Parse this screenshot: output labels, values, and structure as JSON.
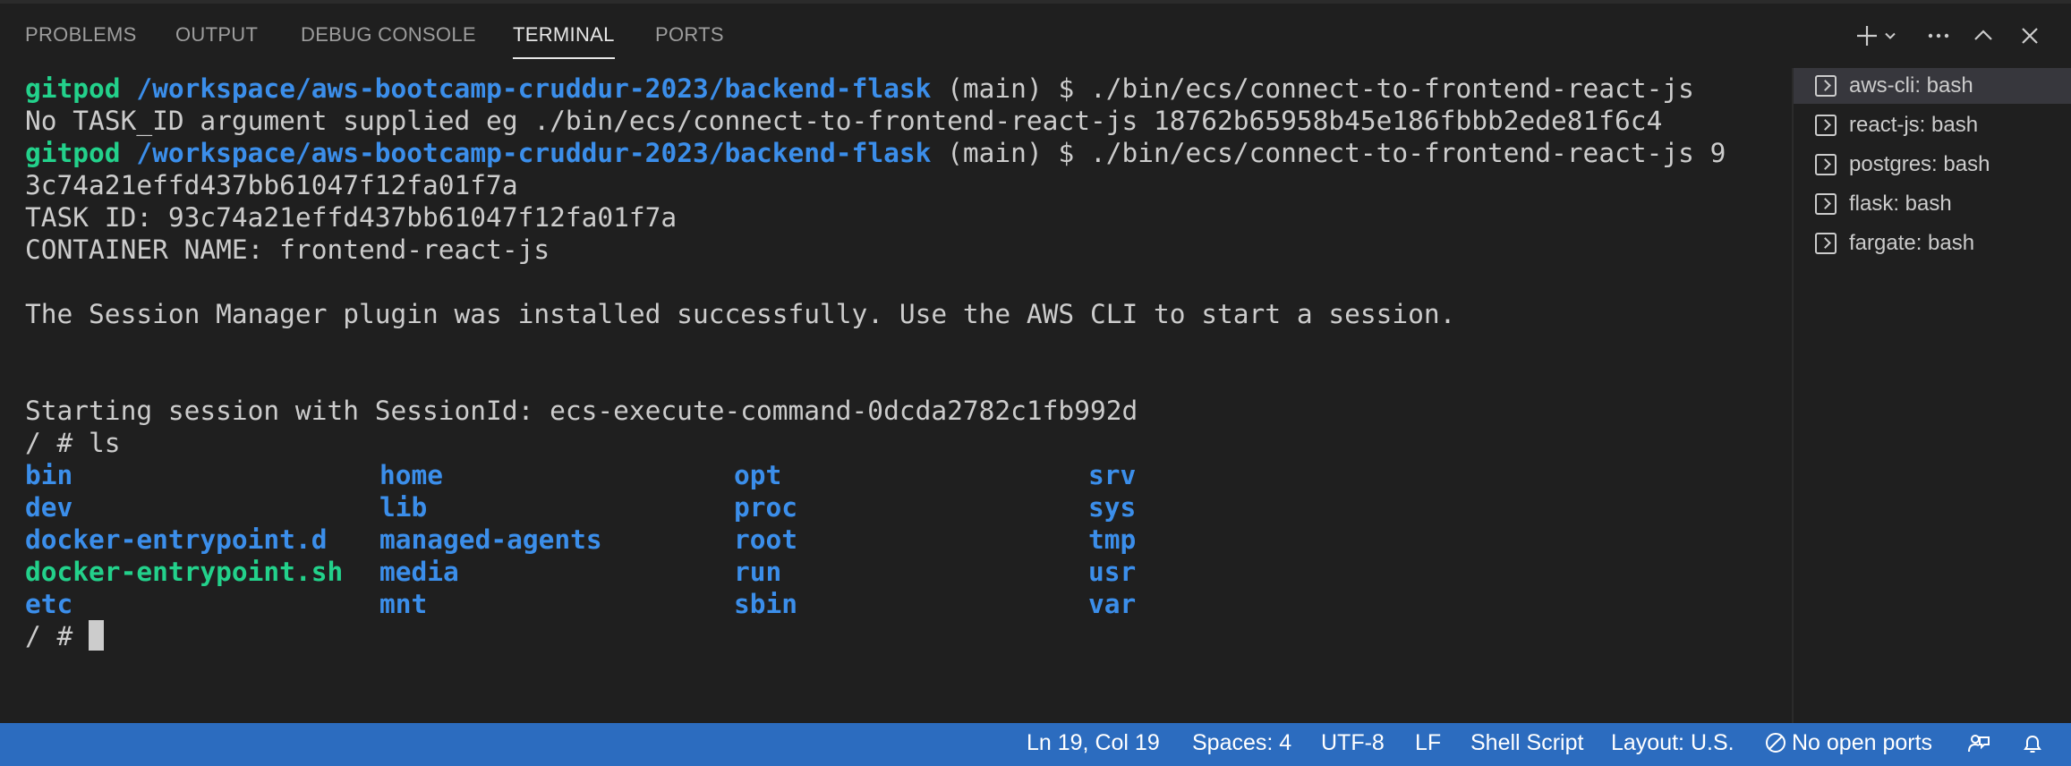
{
  "panel_tabs": [
    {
      "label": "PROBLEMS"
    },
    {
      "label": "OUTPUT"
    },
    {
      "label": "DEBUG CONSOLE"
    },
    {
      "label": "TERMINAL"
    },
    {
      "label": "PORTS"
    }
  ],
  "active_tab": "TERMINAL",
  "toolbar_icons": [
    "plus-icon",
    "chevron-down-icon",
    "more-icon",
    "chevron-up-icon",
    "close-icon"
  ],
  "terminal": {
    "prompt_user": "gitpod",
    "prompt_path": "/workspace/aws-bootcamp-cruddur-2023/backend-flask",
    "prompt_branch": " (main) $ ",
    "cmd1": "./bin/ecs/connect-to-frontend-react-js",
    "line2": "No TASK_ID argument supplied eg ./bin/ecs/connect-to-frontend-react-js 18762b65958b45e186fbbb2ede81f6c4",
    "cmd2": "./bin/ecs/connect-to-frontend-react-js 9",
    "cmd2_wrap": "3c74a21effd437bb61047f12fa01f7a",
    "task_id": "TASK ID: 93c74a21effd437bb61047f12fa01f7a",
    "container_name": "CONTAINER NAME: frontend-react-js",
    "session_plugin": "The Session Manager plugin was installed successfully. Use the AWS CLI to start a session.",
    "session_start": "Starting session with SessionId: ecs-execute-command-0dcda2782c1fb992d",
    "ls_cmd": "/ # ls",
    "prompt_final": "/ # ",
    "ls_columns": [
      [
        "bin",
        "dev",
        "docker-entrypoint.d",
        "docker-entrypoint.sh",
        "etc"
      ],
      [
        "home",
        "lib",
        "managed-agents",
        "media",
        "mnt"
      ],
      [
        "opt",
        "proc",
        "root",
        "run",
        "sbin"
      ],
      [
        "srv",
        "sys",
        "tmp",
        "usr",
        "var"
      ]
    ],
    "executable_entries": [
      "docker-entrypoint.sh"
    ]
  },
  "terminal_list": [
    {
      "label": "aws-cli: bash",
      "active": true
    },
    {
      "label": "react-js: bash",
      "active": false
    },
    {
      "label": "postgres: bash",
      "active": false
    },
    {
      "label": "flask: bash",
      "active": false
    },
    {
      "label": "fargate: bash",
      "active": false
    }
  ],
  "statusbar": {
    "cursor_pos": "Ln 19, Col 19",
    "spaces": "Spaces: 4",
    "encoding": "UTF-8",
    "eol": "LF",
    "language": "Shell Script",
    "layout": "Layout: U.S.",
    "ports": "No open ports"
  },
  "colors": {
    "statusbar_bg": "#2c6cbf",
    "prompt_user": "#23d18b",
    "prompt_path": "#3b8eea",
    "directory": "#3b8eea",
    "executable": "#23d18b"
  }
}
